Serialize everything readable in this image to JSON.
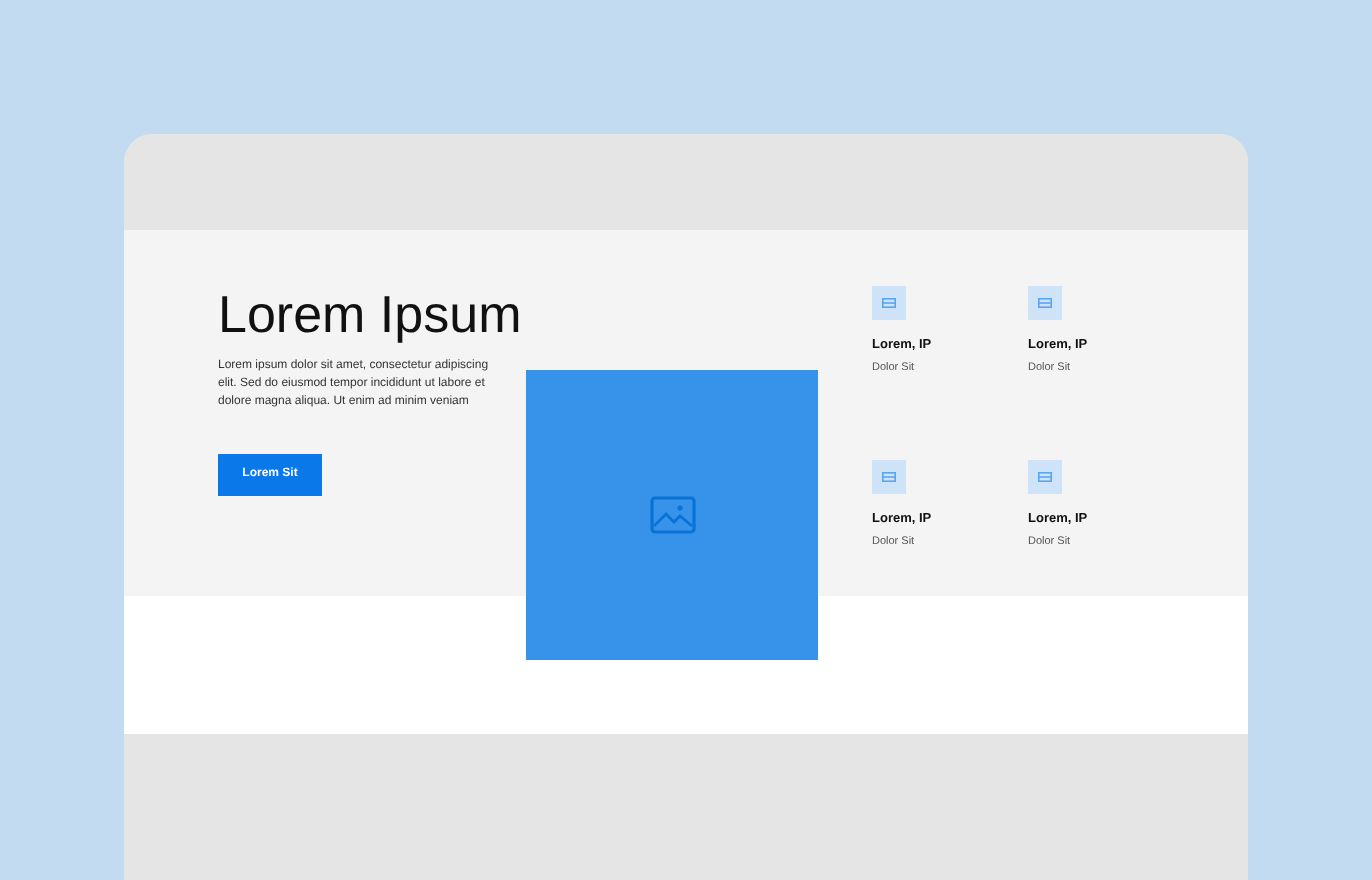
{
  "hero": {
    "title": "Lorem Ipsum",
    "text": "Lorem ipsum dolor sit amet, consectetur adipiscing elit. Sed do eiusmod tempor incididunt ut labore et dolore magna aliqua. Ut enim ad minim veniam",
    "button": "Lorem Sit"
  },
  "features": [
    {
      "title": "Lorem, IP",
      "subtitle": "Dolor Sit"
    },
    {
      "title": "Lorem, IP",
      "subtitle": "Dolor Sit"
    },
    {
      "title": "Lorem, IP",
      "subtitle": "Dolor Sit"
    },
    {
      "title": "Lorem, IP",
      "subtitle": "Dolor Sit"
    }
  ]
}
